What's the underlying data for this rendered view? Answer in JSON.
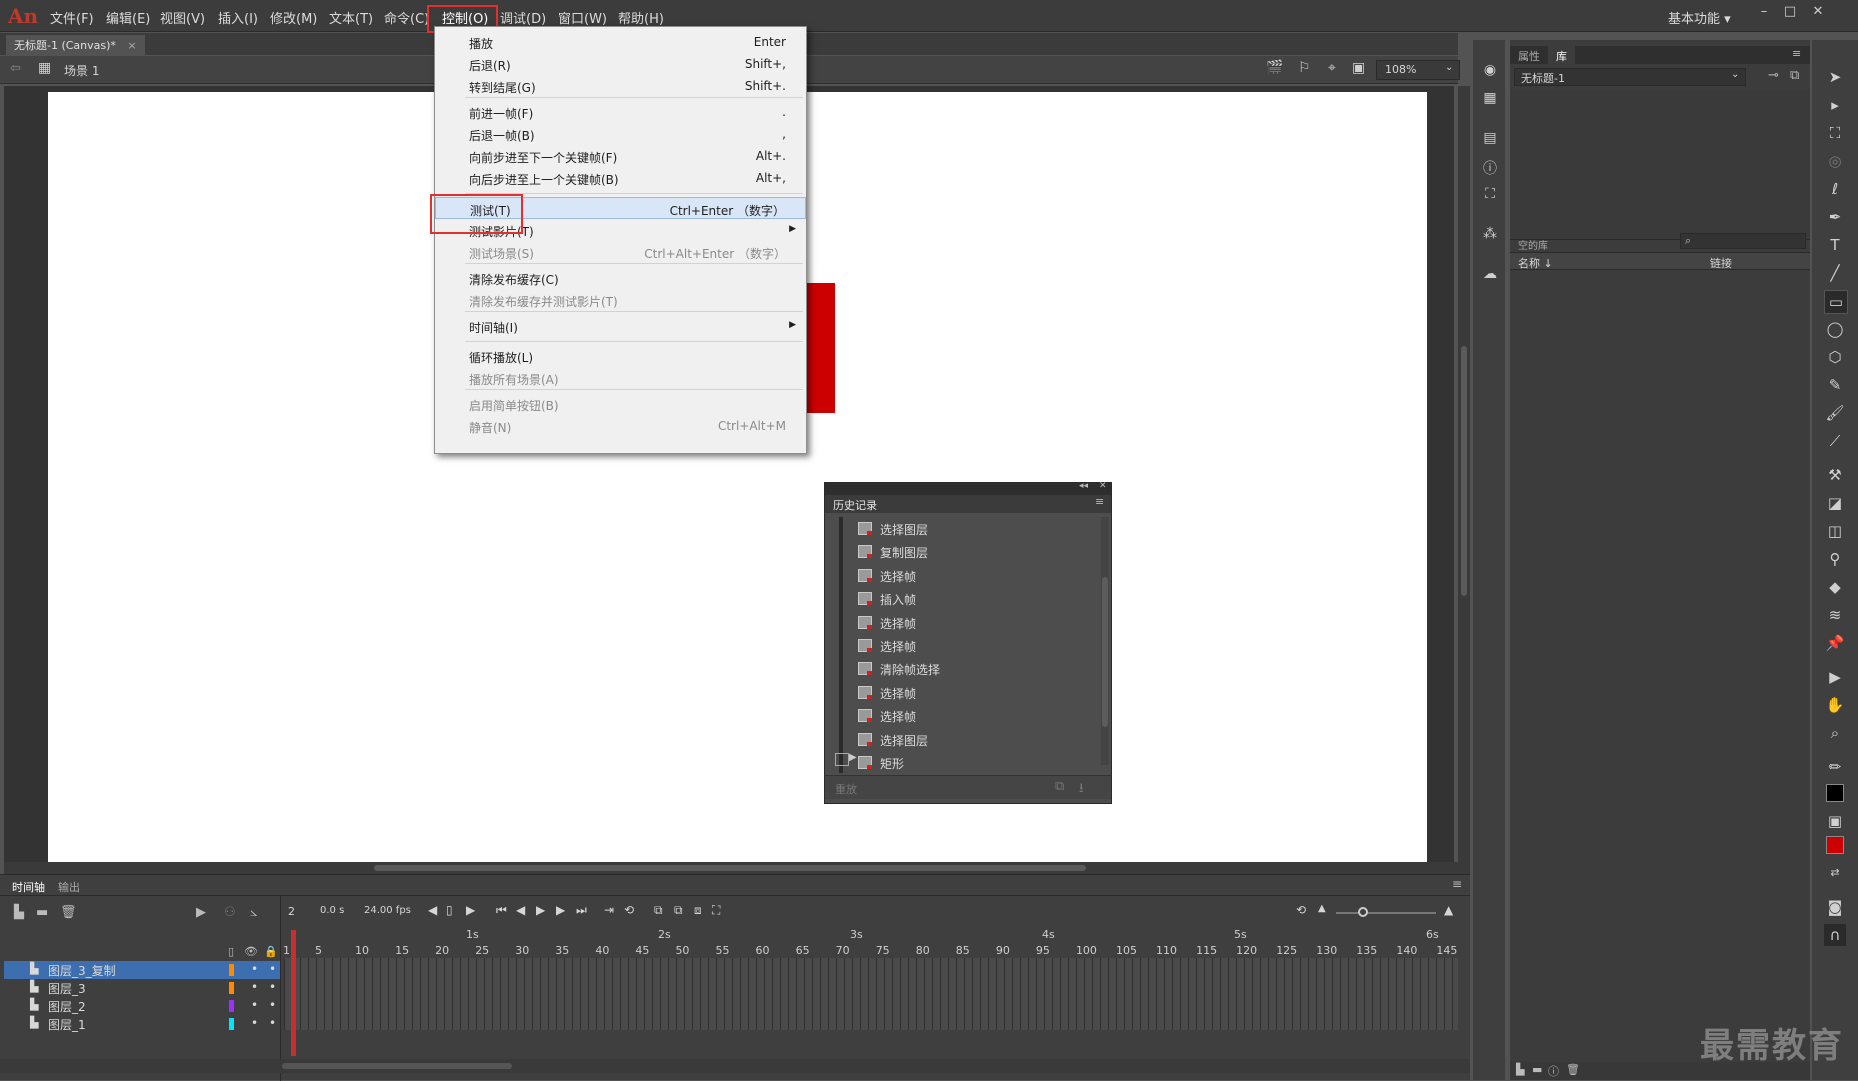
{
  "app": {
    "logo": "An"
  },
  "menubar": {
    "items": [
      "文件(F)",
      "编辑(E)",
      "视图(V)",
      "插入(I)",
      "修改(M)",
      "文本(T)",
      "命令(C)",
      "控制(O)",
      "调试(D)",
      "窗口(W)",
      "帮助(H)"
    ],
    "workspace": "基本功能 ▾"
  },
  "doc": {
    "tab_title": "无标题-1 (Canvas)*",
    "tab_close": "×",
    "scene": "场景 1",
    "zoom": "108%"
  },
  "control_menu": {
    "items": [
      {
        "label": "播放",
        "shortcut": "Enter",
        "disabled": false
      },
      {
        "label": "后退(R)",
        "shortcut": "Shift+,",
        "disabled": false
      },
      {
        "label": "转到结尾(G)",
        "shortcut": "Shift+.",
        "disabled": false
      },
      {
        "label": "前进一帧(F)",
        "shortcut": ".",
        "disabled": false
      },
      {
        "label": "后退一帧(B)",
        "shortcut": ",",
        "disabled": false
      },
      {
        "label": "向前步进至下一个关键帧(F)",
        "shortcut": "Alt+.",
        "disabled": false
      },
      {
        "label": "向后步进至上一个关键帧(B)",
        "shortcut": "Alt+,",
        "disabled": false
      },
      {
        "label": "测试(T)",
        "shortcut": "Ctrl+Enter （数字）",
        "disabled": false
      },
      {
        "label": "测试影片(T)",
        "shortcut": "",
        "disabled": false
      },
      {
        "label": "测试场景(S)",
        "shortcut": "Ctrl+Alt+Enter （数字）",
        "disabled": true
      },
      {
        "label": "清除发布缓存(C)",
        "shortcut": "",
        "disabled": false
      },
      {
        "label": "清除发布缓存并测试影片(T)",
        "shortcut": "",
        "disabled": true
      },
      {
        "label": "时间轴(I)",
        "shortcut": "",
        "disabled": false
      },
      {
        "label": "循环播放(L)",
        "shortcut": "",
        "disabled": false
      },
      {
        "label": "播放所有场景(A)",
        "shortcut": "",
        "disabled": true
      },
      {
        "label": "启用简单按钮(B)",
        "shortcut": "",
        "disabled": true
      },
      {
        "label": "静音(N)",
        "shortcut": "Ctrl+Alt+M",
        "disabled": true
      }
    ]
  },
  "library": {
    "tabs": [
      "属性",
      "库"
    ],
    "doc_select": "无标题-1",
    "empty_label": "空的库",
    "col_name": "名称 ↓",
    "col_link": "链接"
  },
  "history": {
    "title": "历史记录",
    "items": [
      "选择图层",
      "复制图层",
      "选择帧",
      "插入帧",
      "选择帧",
      "选择帧",
      "清除帧选择",
      "选择帧",
      "选择帧",
      "选择图层",
      "矩形"
    ],
    "replay": "重放"
  },
  "timeline": {
    "tabs": [
      "时间轴",
      "输出"
    ],
    "frame": "2",
    "time": "0.0 s",
    "fps": "24.00 fps",
    "layers": [
      "图层_3_复制",
      "图层_3",
      "图层_2",
      "图层_1"
    ],
    "layer_colors": [
      "#ff8a00",
      "#ff8a00",
      "#9b30ff",
      "#00e5ff"
    ],
    "ruler": [
      "1",
      "5",
      "10",
      "15",
      "20",
      "25",
      "30",
      "35",
      "40",
      "45",
      "50",
      "55",
      "60",
      "65",
      "70",
      "75",
      "80",
      "85",
      "90",
      "95",
      "100",
      "105",
      "110",
      "115",
      "120",
      "125",
      "130",
      "135",
      "140",
      "145"
    ],
    "seconds": [
      "1s",
      "2s",
      "3s",
      "4s",
      "5s",
      "6s"
    ]
  },
  "watermark": "最需教育"
}
